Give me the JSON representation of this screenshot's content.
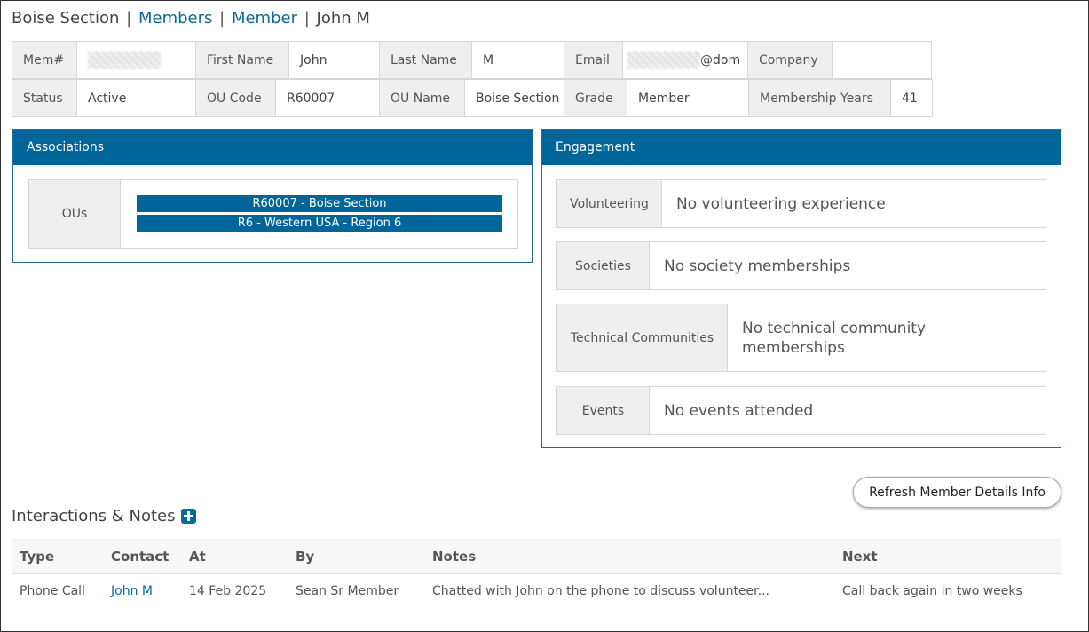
{
  "breadcrumb": {
    "section": "Boise Section",
    "members": "Members",
    "member": "Member",
    "current": "John M",
    "separator": "|"
  },
  "member_info": {
    "row1": {
      "mem_label": "Mem#",
      "mem_value": "",
      "first_name_label": "First Name",
      "first_name": "John",
      "last_name_label": "Last Name",
      "last_name": "M",
      "email_label": "Email",
      "email_suffix": "@dom",
      "company_label": "Company",
      "company": ""
    },
    "row2": {
      "status_label": "Status",
      "status": "Active",
      "ou_code_label": "OU Code",
      "ou_code": "R60007",
      "ou_name_label": "OU Name",
      "ou_name": "Boise Section",
      "grade_label": "Grade",
      "grade": "Member",
      "membership_years_label": "Membership Years",
      "membership_years": "41"
    }
  },
  "associations": {
    "title": "Associations",
    "ous_label": "OUs",
    "ous": [
      "R60007 - Boise Section",
      "R6 - Western USA - Region 6"
    ]
  },
  "engagement": {
    "title": "Engagement",
    "items": [
      {
        "label": "Volunteering",
        "value": "No volunteering experience"
      },
      {
        "label": "Societies",
        "value": "No society memberships"
      },
      {
        "label": "Technical Communities",
        "value": "No technical community memberships"
      },
      {
        "label": "Events",
        "value": "No events attended"
      }
    ]
  },
  "refresh_button": "Refresh Member Details Info",
  "interactions": {
    "title": "Interactions & Notes",
    "columns": [
      "Type",
      "Contact",
      "At",
      "By",
      "Notes",
      "Next"
    ],
    "rows": [
      {
        "type": "Phone Call",
        "contact": "John M",
        "at": "14 Feb 2025",
        "by": "Sean Sr Member",
        "notes": "Chatted with John on the phone to discuss volunteer...",
        "next": "Call back again in two weeks"
      }
    ]
  },
  "colors": {
    "accent": "#006699",
    "link": "#0a6a93",
    "label_bg": "#efefef"
  }
}
